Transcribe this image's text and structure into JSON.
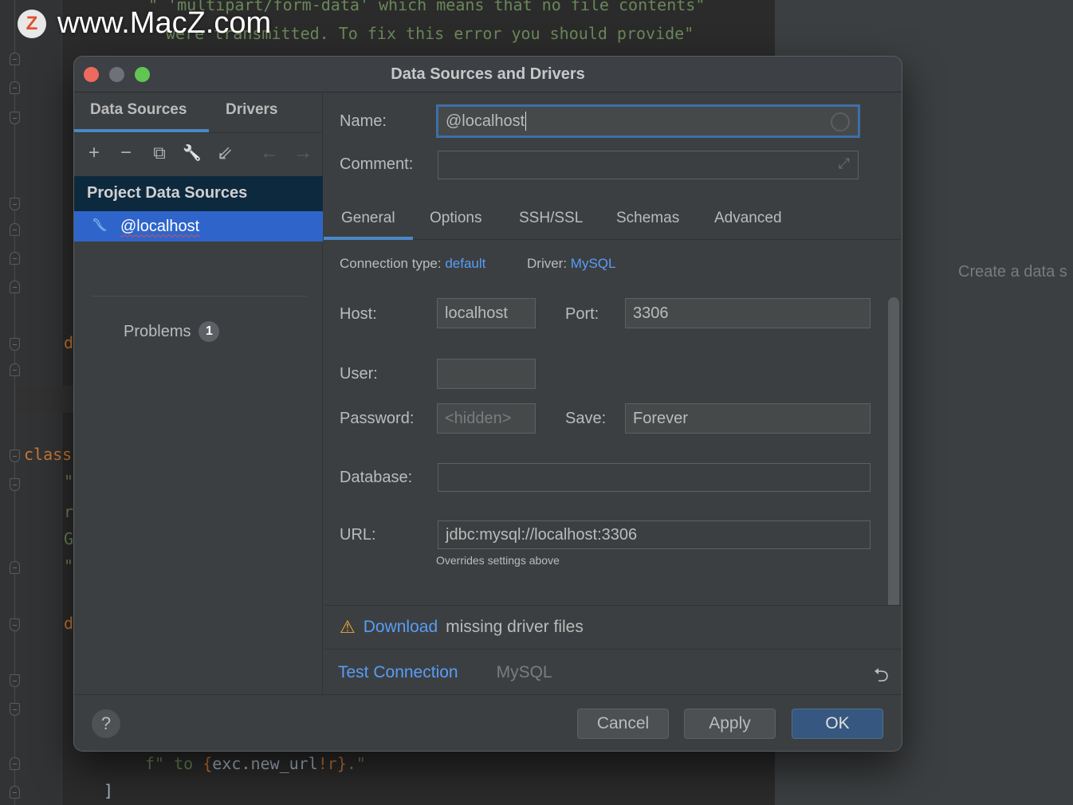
{
  "watermark": {
    "logo": "Z",
    "text": "www.MacZ.com"
  },
  "editor": {
    "lines": [
      "\" 'multipart/form-data' which means that no file contents\"",
      "were transmitted. To fix this error you should provide\"",
      "d",
      "class",
      "\"",
      "r",
      "G",
      "\"",
      "d"
    ],
    "bottom_line_prefix": "f\" to ",
    "bottom_line_brace_open": "{",
    "bottom_line_expr": "exc.new_url",
    "bottom_line_conv": "!r",
    "bottom_line_brace_close": "}",
    "bottom_line_suffix": ".\"",
    "closing_bracket": "]"
  },
  "right_panel": {
    "hint": "Create a data s"
  },
  "dialog": {
    "title": "Data Sources and Drivers",
    "left": {
      "tabs": [
        "Data Sources",
        "Drivers"
      ],
      "active_tab": "Data Sources",
      "toolbar": {
        "add": "+",
        "remove": "−",
        "duplicate": "⧉",
        "properties": "🔧",
        "import": "⇙",
        "back": "←",
        "forward": "→"
      },
      "section_header": "Project Data Sources",
      "selected_item": "@localhost",
      "problems_label": "Problems",
      "problems_count": "1"
    },
    "form": {
      "name_label": "Name:",
      "name_value": "@localhost",
      "comment_label": "Comment:",
      "comment_value": "",
      "tabs": [
        "General",
        "Options",
        "SSH/SSL",
        "Schemas",
        "Advanced"
      ],
      "active_tab": "General",
      "connection_type_label": "Connection type:",
      "connection_type_value": "default",
      "driver_label": "Driver:",
      "driver_value": "MySQL",
      "host_label": "Host:",
      "host_value": "localhost",
      "port_label": "Port:",
      "port_value": "3306",
      "user_label": "User:",
      "user_value": "",
      "password_label": "Password:",
      "password_placeholder": "<hidden>",
      "save_label": "Save:",
      "save_value": "Forever",
      "database_label": "Database:",
      "database_value": "",
      "url_label": "URL:",
      "url_value": "jdbc:mysql://localhost:3306",
      "url_hint": "Overrides settings above"
    },
    "warning": {
      "link": "Download",
      "text": "missing driver files"
    },
    "test_bar": {
      "test_connection": "Test Connection",
      "driver": "MySQL"
    },
    "footer": {
      "help": "?",
      "cancel": "Cancel",
      "apply": "Apply",
      "ok": "OK"
    }
  },
  "colors": {
    "accent": "#4a88c7",
    "selection": "#2f65ca",
    "link": "#589df6",
    "warning": "#f0a732",
    "primary_button": "#365880"
  }
}
